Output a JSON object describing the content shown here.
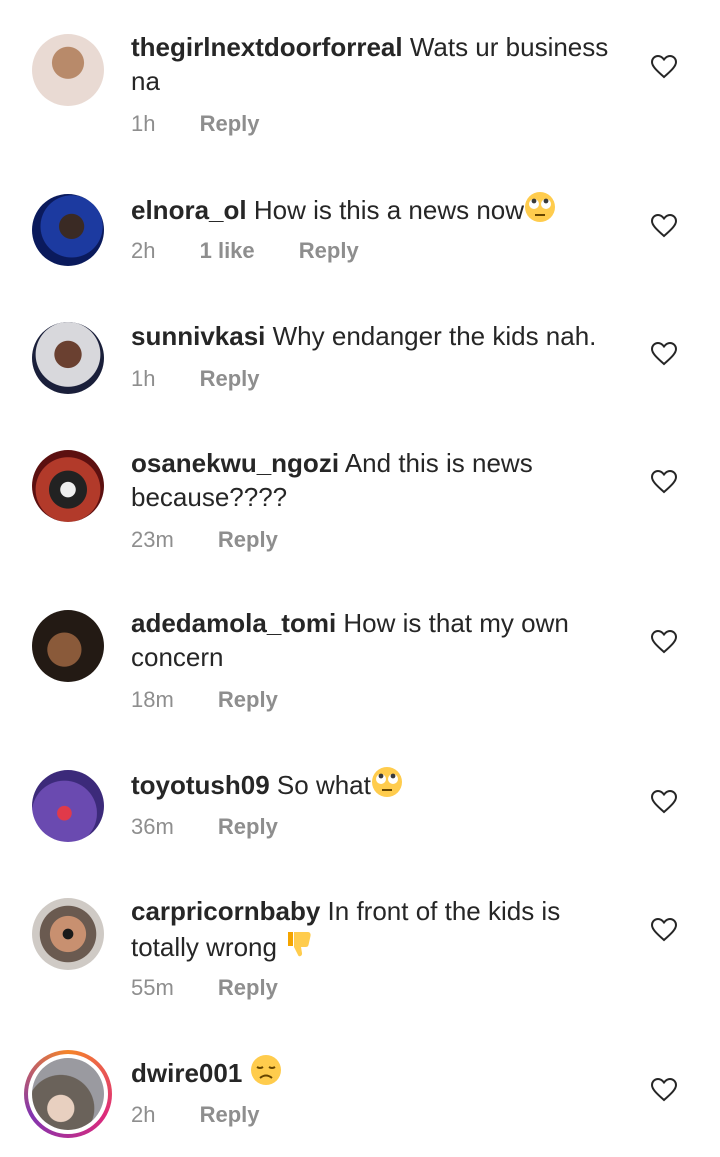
{
  "comments": [
    {
      "username": "thegirlnextdoorforreal",
      "text": "Wats ur business na",
      "time": "1h",
      "likes": "",
      "reply": "Reply",
      "avatar_colors": [
        "#e9dad3",
        "#b88a6a"
      ]
    },
    {
      "username": "elnora_ol",
      "text": "How is this a news now",
      "emoji": "eye-roll-emoji",
      "time": "2h",
      "likes": "1 like",
      "reply": "Reply",
      "avatar_colors": [
        "#0a1a5c",
        "#1c3aa0"
      ]
    },
    {
      "username": "sunnivkasi",
      "text": "Why endanger the kids nah.",
      "time": "1h",
      "likes": "",
      "reply": "Reply",
      "avatar_colors": [
        "#1a1f3a",
        "#3a5ba8"
      ]
    },
    {
      "username": "osanekwu_ngozi",
      "text": "And this is news because????",
      "time": "23m",
      "likes": "",
      "reply": "Reply",
      "avatar_colors": [
        "#5c1010",
        "#b23a2a"
      ]
    },
    {
      "username": "adedamola_tomi",
      "text": "How is that my own concern",
      "time": "18m",
      "likes": "",
      "reply": "Reply",
      "avatar_colors": [
        "#231a14",
        "#8a5a3a"
      ]
    },
    {
      "username": "toyotush09",
      "text": "So what",
      "emoji": "eye-roll-emoji",
      "time": "36m",
      "likes": "",
      "reply": "Reply",
      "avatar_colors": [
        "#3c2a7a",
        "#6a4ab0"
      ]
    },
    {
      "username": "carpricornbaby",
      "text": "In front of the kids is totally wrong",
      "emoji": "thumbs-down-emoji",
      "time": "55m",
      "likes": "",
      "reply": "Reply",
      "avatar_colors": [
        "#cfcac5",
        "#6a5a50"
      ]
    },
    {
      "username": "dwire001",
      "text": "",
      "emoji": "disappointed-emoji",
      "time": "2h",
      "likes": "",
      "reply": "Reply",
      "avatar_colors": [
        "#9a9aa0",
        "#6a625a"
      ]
    }
  ]
}
